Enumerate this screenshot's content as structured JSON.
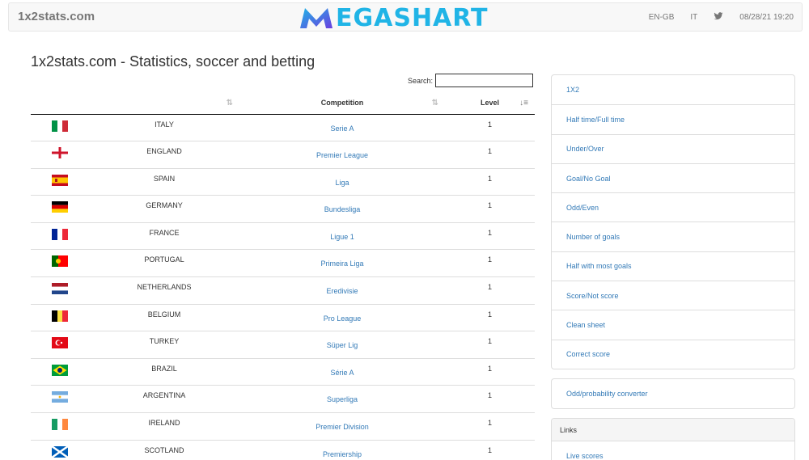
{
  "navbar": {
    "brand": "1x2stats.com",
    "logo_text": "EGASHART",
    "language": "EN-GB",
    "lang_alt": "IT",
    "datetime": "08/28/21 19:20"
  },
  "page_title": "1x2stats.com - Statistics, soccer and betting",
  "search": {
    "label": "Search:",
    "value": ""
  },
  "table": {
    "headers": {
      "flag": "",
      "country": "",
      "competition": "Competition",
      "level": "Level"
    },
    "rows": [
      {
        "flag": "italy",
        "country": "ITALY",
        "competition": "Serie A",
        "level": "1"
      },
      {
        "flag": "england",
        "country": "ENGLAND",
        "competition": "Premier League",
        "level": "1"
      },
      {
        "flag": "spain",
        "country": "SPAIN",
        "competition": "Liga",
        "level": "1"
      },
      {
        "flag": "germany",
        "country": "GERMANY",
        "competition": "Bundesliga",
        "level": "1"
      },
      {
        "flag": "france",
        "country": "FRANCE",
        "competition": "Ligue 1",
        "level": "1"
      },
      {
        "flag": "portugal",
        "country": "PORTUGAL",
        "competition": "Primeira Liga",
        "level": "1"
      },
      {
        "flag": "netherlands",
        "country": "NETHERLANDS",
        "competition": "Eredivisie",
        "level": "1"
      },
      {
        "flag": "belgium",
        "country": "BELGIUM",
        "competition": "Pro League",
        "level": "1"
      },
      {
        "flag": "turkey",
        "country": "TURKEY",
        "competition": "Süper Lig",
        "level": "1"
      },
      {
        "flag": "brazil",
        "country": "BRAZIL",
        "competition": "Série A",
        "level": "1"
      },
      {
        "flag": "argentina",
        "country": "ARGENTINA",
        "competition": "Superliga",
        "level": "1"
      },
      {
        "flag": "ireland",
        "country": "IRELAND",
        "competition": "Premier Division",
        "level": "1"
      },
      {
        "flag": "scotland",
        "country": "SCOTLAND",
        "competition": "Premiership",
        "level": "1"
      }
    ]
  },
  "sidebar": {
    "markets": [
      "1X2",
      "Half time/Full time",
      "Under/Over",
      "Goal/No Goal",
      "Odd/Even",
      "Number of goals",
      "Half with most goals",
      "Score/Not score",
      "Clean sheet",
      "Correct score"
    ],
    "converter": "Odd/probability converter",
    "links_header": "Links",
    "links": [
      "Live scores"
    ]
  },
  "colors": {
    "link": "#337ab7",
    "logo_cyan": "#20b4e6",
    "logo_purple": "#6a3ee0"
  }
}
